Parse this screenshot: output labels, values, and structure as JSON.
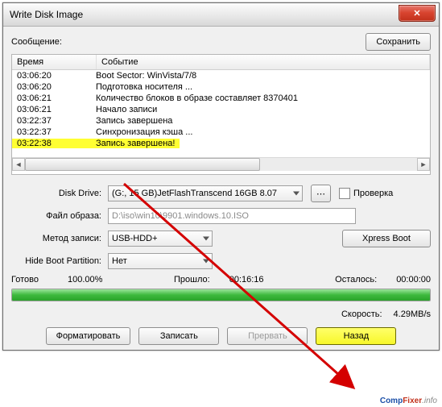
{
  "window": {
    "title": "Write Disk Image"
  },
  "labels": {
    "message": "Сообщение:",
    "save": "Сохранить",
    "col_time": "Время",
    "col_event": "Событие",
    "disk_drive": "Disk Drive:",
    "verify": "Проверка",
    "image_file": "Файл образа:",
    "write_method": "Метод записи:",
    "xpress_boot": "Xpress Boot",
    "hide_boot": "Hide Boot Partition:",
    "ready": "Готово",
    "elapsed": "Прошло:",
    "remain": "Осталось:",
    "speed": "Скорость:",
    "format": "Форматировать",
    "write": "Записать",
    "abort": "Прервать",
    "back": "Назад"
  },
  "log": [
    {
      "time": "03:06:20",
      "event": "Boot Sector: WinVista/7/8"
    },
    {
      "time": "03:06:20",
      "event": "Подготовка носителя ..."
    },
    {
      "time": "03:06:21",
      "event": "Количество блоков в образе составляет 8370401"
    },
    {
      "time": "03:06:21",
      "event": "Начало записи"
    },
    {
      "time": "03:22:37",
      "event": "Запись завершена"
    },
    {
      "time": "03:22:37",
      "event": "Синхронизация кэша ..."
    },
    {
      "time": "03:22:38",
      "event": "Запись завершена!",
      "highlight": true
    }
  ],
  "form": {
    "disk_drive_value": "(G:, 15 GB)JetFlashTranscend 16GB  8.07",
    "image_file_value": "D:\\iso\\win10\\9901.windows.10.ISO",
    "write_method_value": "USB-HDD+",
    "hide_boot_value": "Нет"
  },
  "status": {
    "percent": "100.00%",
    "elapsed": "00:16:16",
    "remain": "00:00:00",
    "speed": "4.29MB/s"
  },
  "watermark": {
    "a": "Comp",
    "b": "Fixer",
    "c": ".info"
  }
}
